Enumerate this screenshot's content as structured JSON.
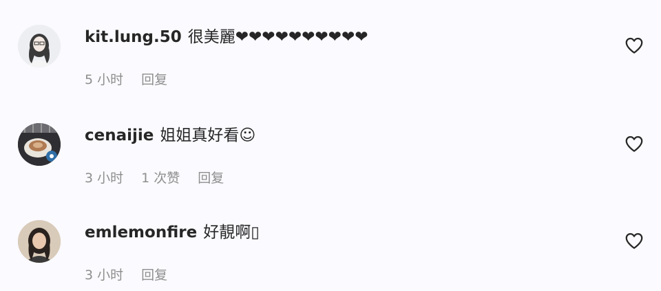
{
  "comments": [
    {
      "username": "kit.lung.50",
      "text": "很美麗❤❤❤❤❤❤❤❤❤❤",
      "time": "5 小时",
      "likes": "",
      "reply": "回复",
      "avatar_icon": "avatar-woman-light"
    },
    {
      "username": "cenaijie",
      "text": "姐姐真好看☺",
      "time": "3 小时",
      "likes": "1 次赞",
      "reply": "回复",
      "avatar_icon": "avatar-coffee-cup"
    },
    {
      "username": "emlemonfire",
      "text": "好靚啊▯",
      "time": "3 小时",
      "likes": "",
      "reply": "回复",
      "avatar_icon": "avatar-woman-dark"
    }
  ],
  "colors": {
    "background": "#fafaff",
    "text": "#262626",
    "meta": "#8e8e8e"
  }
}
